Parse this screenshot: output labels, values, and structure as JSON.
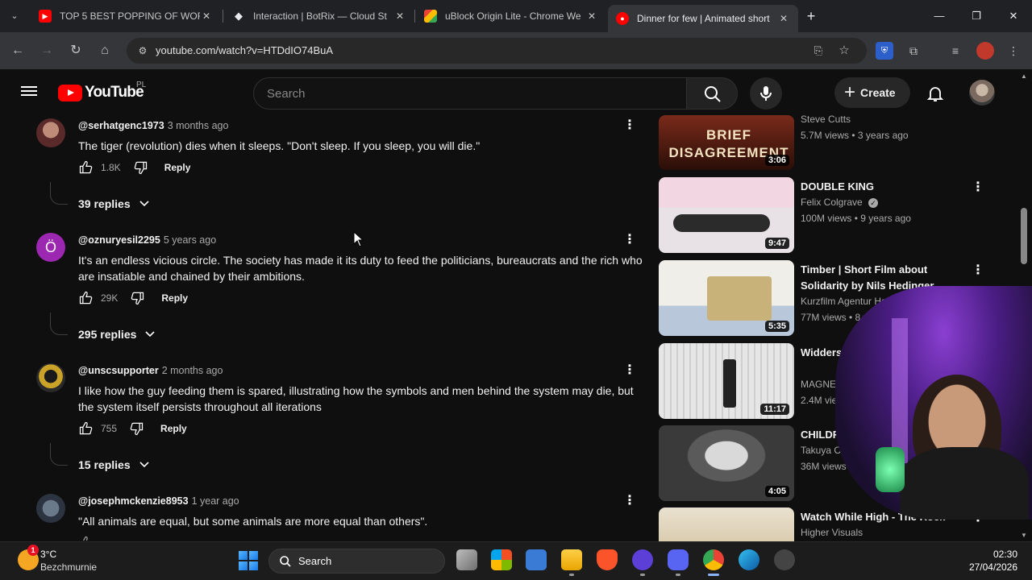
{
  "browser": {
    "tabs": [
      {
        "title": "TOP 5 BEST POPPING OF WORL",
        "favicon": "youtube-favicon",
        "active": false
      },
      {
        "title": "Interaction | BotRix — Cloud St",
        "favicon": "botrix-favicon",
        "active": false
      },
      {
        "title": "uBlock Origin Lite - Chrome We",
        "favicon": "chrome-webstore-favicon",
        "active": false
      },
      {
        "title": "Dinner for few | Animated short",
        "favicon": "youtube-favicon",
        "active": true
      }
    ],
    "url": "youtube.com/watch?v=HTDdIO74BuA",
    "new_tab_label": "+"
  },
  "youtube": {
    "logo_text": "YouTube",
    "country_code": "PL",
    "search_placeholder": "Search",
    "create_label": "Create"
  },
  "comments": [
    {
      "handle": "@serhatgenc1973",
      "time": "3 months ago",
      "text": "The tiger (revolution) dies when it sleeps. \"Don't sleep. If you sleep, you will die.\"",
      "likes": "1.8K",
      "reply_label": "Reply",
      "replies": "39 replies"
    },
    {
      "handle": "@oznuryesil2295",
      "time": "5 years ago",
      "avatar_letter": "Ö",
      "text": "It's an endless vicious circle. The society has made it its duty to feed the politicians, bureaucrats and the rich who are insatiable and chained by their ambitions.",
      "likes": "29K",
      "reply_label": "Reply",
      "replies": "295 replies"
    },
    {
      "handle": "@unscsupporter",
      "time": "2 months ago",
      "text": "I like how the guy feeding them is spared, illustrating how the symbols and men behind the system may die, but the system itself persists throughout all iterations",
      "likes": "755",
      "reply_label": "Reply",
      "replies": "15 replies"
    },
    {
      "handle": "@josephmckenzie8953",
      "time": "1 year ago",
      "text": "\"All animals are equal, but some animals are more equal than others\".",
      "likes": "",
      "reply_label": ""
    }
  ],
  "related": [
    {
      "title": "",
      "channel": "Steve Cutts",
      "meta": "5.7M views • 3 years ago",
      "duration": "3:06",
      "thumb_text": "BRIEF DISAGREEMENT"
    },
    {
      "title": "DOUBLE KING",
      "channel": "Felix Colgrave",
      "verified": true,
      "meta": "100M views • 9 years ago",
      "duration": "9:47"
    },
    {
      "title": "Timber | Short Film about Solidarity by Nils Hedinger",
      "channel": "Kurzfilm Agentur Hamb",
      "meta": "77M views • 8 ye",
      "duration": "5:35"
    },
    {
      "title": "Widdersh film by S",
      "channel": "MAGNE",
      "meta": "2.4M vie",
      "duration": "11:17"
    },
    {
      "title": "CHILDR",
      "channel": "Takuya Oka",
      "meta": "36M views",
      "duration": "4:05"
    },
    {
      "title": "Watch While High - The Rock",
      "channel": "Higher Visuals",
      "meta": "",
      "duration": ""
    }
  ],
  "taskbar": {
    "weather_temp": "3°C",
    "weather_desc": "Bezchmurnie",
    "weather_badge": "1",
    "search_label": "Search",
    "time": "02:30",
    "date": "27/04/2026"
  }
}
